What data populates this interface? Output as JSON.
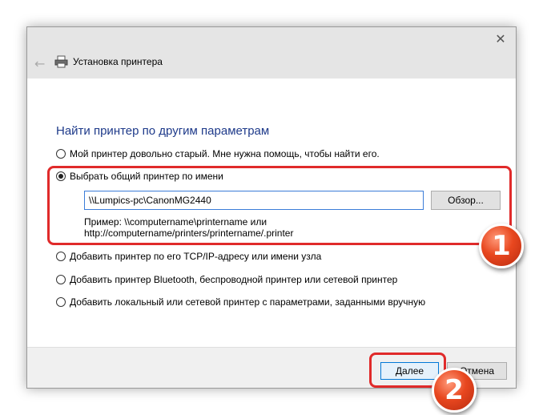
{
  "window": {
    "title": "Установка принтера",
    "close_icon": "✕",
    "back_icon": "←"
  },
  "heading": "Найти принтер по другим параметрам",
  "options": [
    {
      "label": "Мой принтер довольно старый. Мне нужна помощь, чтобы найти его.",
      "checked": false
    },
    {
      "label": "Выбрать общий принтер по имени",
      "checked": true
    },
    {
      "label": "Добавить принтер по его TCP/IP-адресу или имени узла",
      "checked": false
    },
    {
      "label": "Добавить принтер Bluetooth, беспроводной принтер или сетевой принтер",
      "checked": false
    },
    {
      "label": "Добавить локальный или сетевой принтер с параметрами, заданными вручную",
      "checked": false
    }
  ],
  "printer_name": {
    "value": "\\\\Lumpics-pc\\CanonMG2440",
    "browse_label": "Обзор...",
    "example_line1": "Пример: \\\\computername\\printername или",
    "example_line2": "http://computername/printers/printername/.printer"
  },
  "footer": {
    "next_label": "Далее",
    "cancel_label": "Отмена"
  },
  "annotations": {
    "badge1": "1",
    "badge2": "2",
    "highlight_color": "#e02a2a"
  }
}
